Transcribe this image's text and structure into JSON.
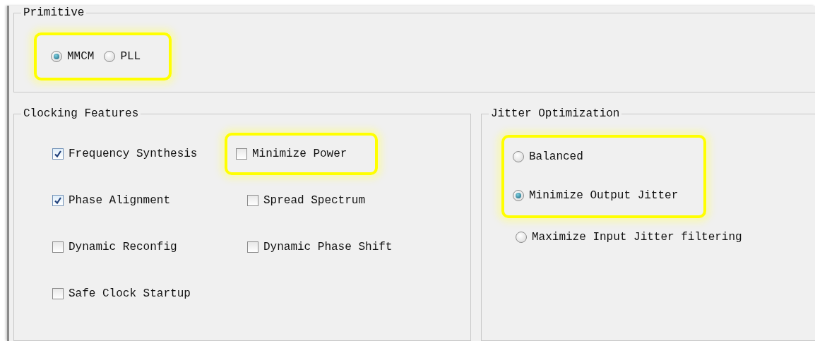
{
  "primitive": {
    "title": "Primitive",
    "highlighted": true,
    "options": [
      {
        "label": "MMCM",
        "selected": true
      },
      {
        "label": "PLL",
        "selected": false
      }
    ]
  },
  "clocking_features": {
    "title": "Clocking Features",
    "columns": [
      [
        {
          "label": "Frequency Synthesis",
          "checked": true,
          "highlighted": false
        },
        {
          "label": "Phase Alignment",
          "checked": true,
          "highlighted": false
        },
        {
          "label": "Dynamic Reconfig",
          "checked": false,
          "highlighted": false
        },
        {
          "label": "Safe Clock Startup",
          "checked": false,
          "highlighted": false
        }
      ],
      [
        {
          "label": "Minimize Power",
          "checked": false,
          "highlighted": true
        },
        {
          "label": "Spread Spectrum",
          "checked": false,
          "highlighted": false
        },
        {
          "label": "Dynamic Phase Shift",
          "checked": false,
          "highlighted": false
        }
      ]
    ]
  },
  "jitter_optimization": {
    "title": "Jitter Optimization",
    "options": [
      {
        "label": "Balanced",
        "selected": false,
        "highlighted": true
      },
      {
        "label": "Minimize Output Jitter",
        "selected": true,
        "highlighted": true
      },
      {
        "label": "Maximize Input Jitter filtering",
        "selected": false,
        "highlighted": false
      }
    ]
  }
}
